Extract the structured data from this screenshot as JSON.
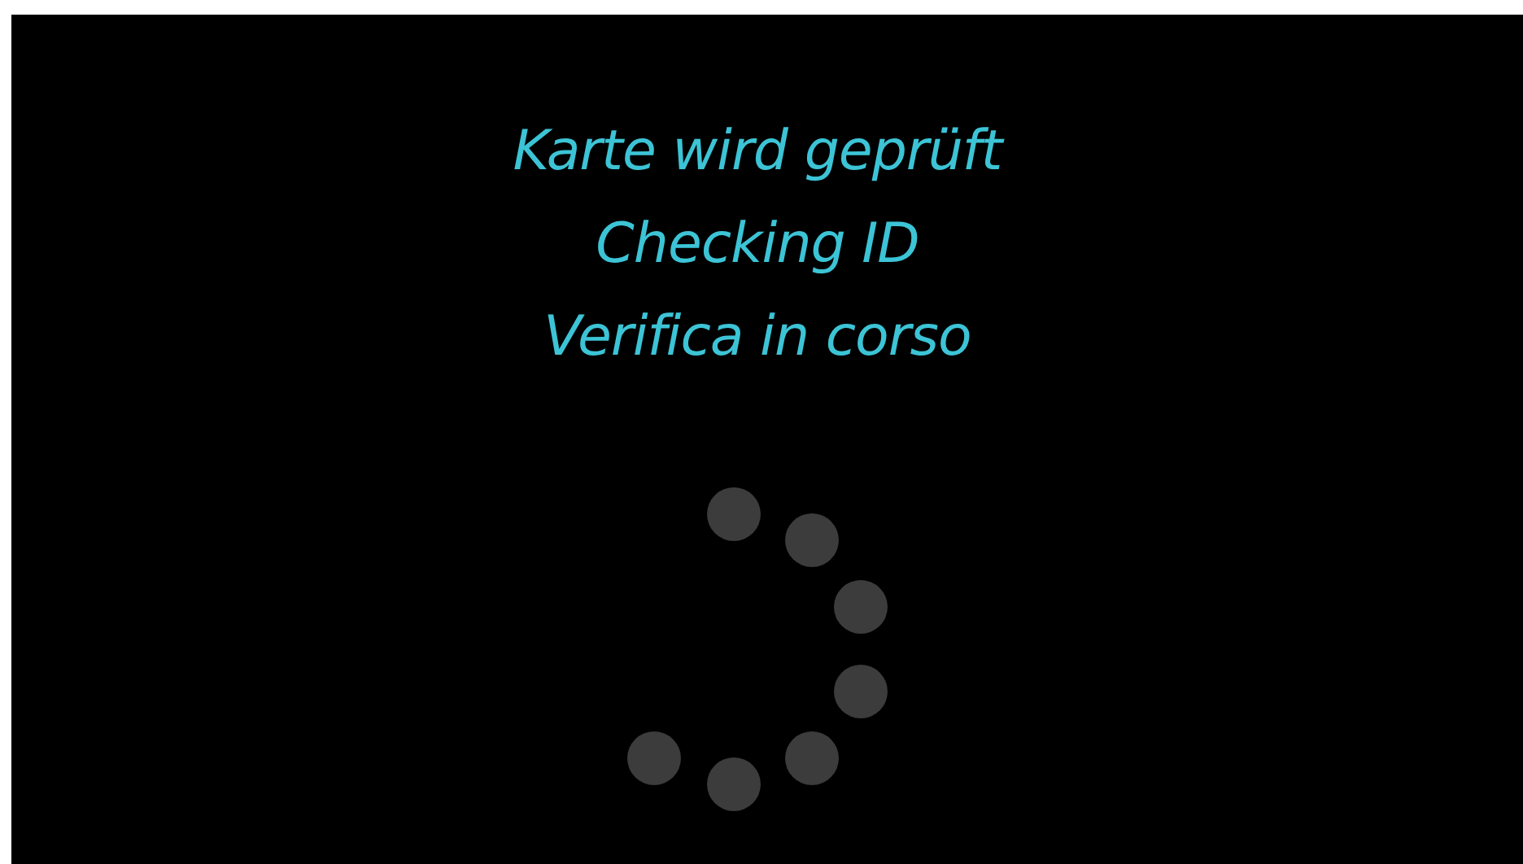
{
  "messages": [
    "Karte wird geprüft",
    "Checking ID",
    "Verifica in corso"
  ],
  "spinner": {
    "kind": "dots"
  }
}
